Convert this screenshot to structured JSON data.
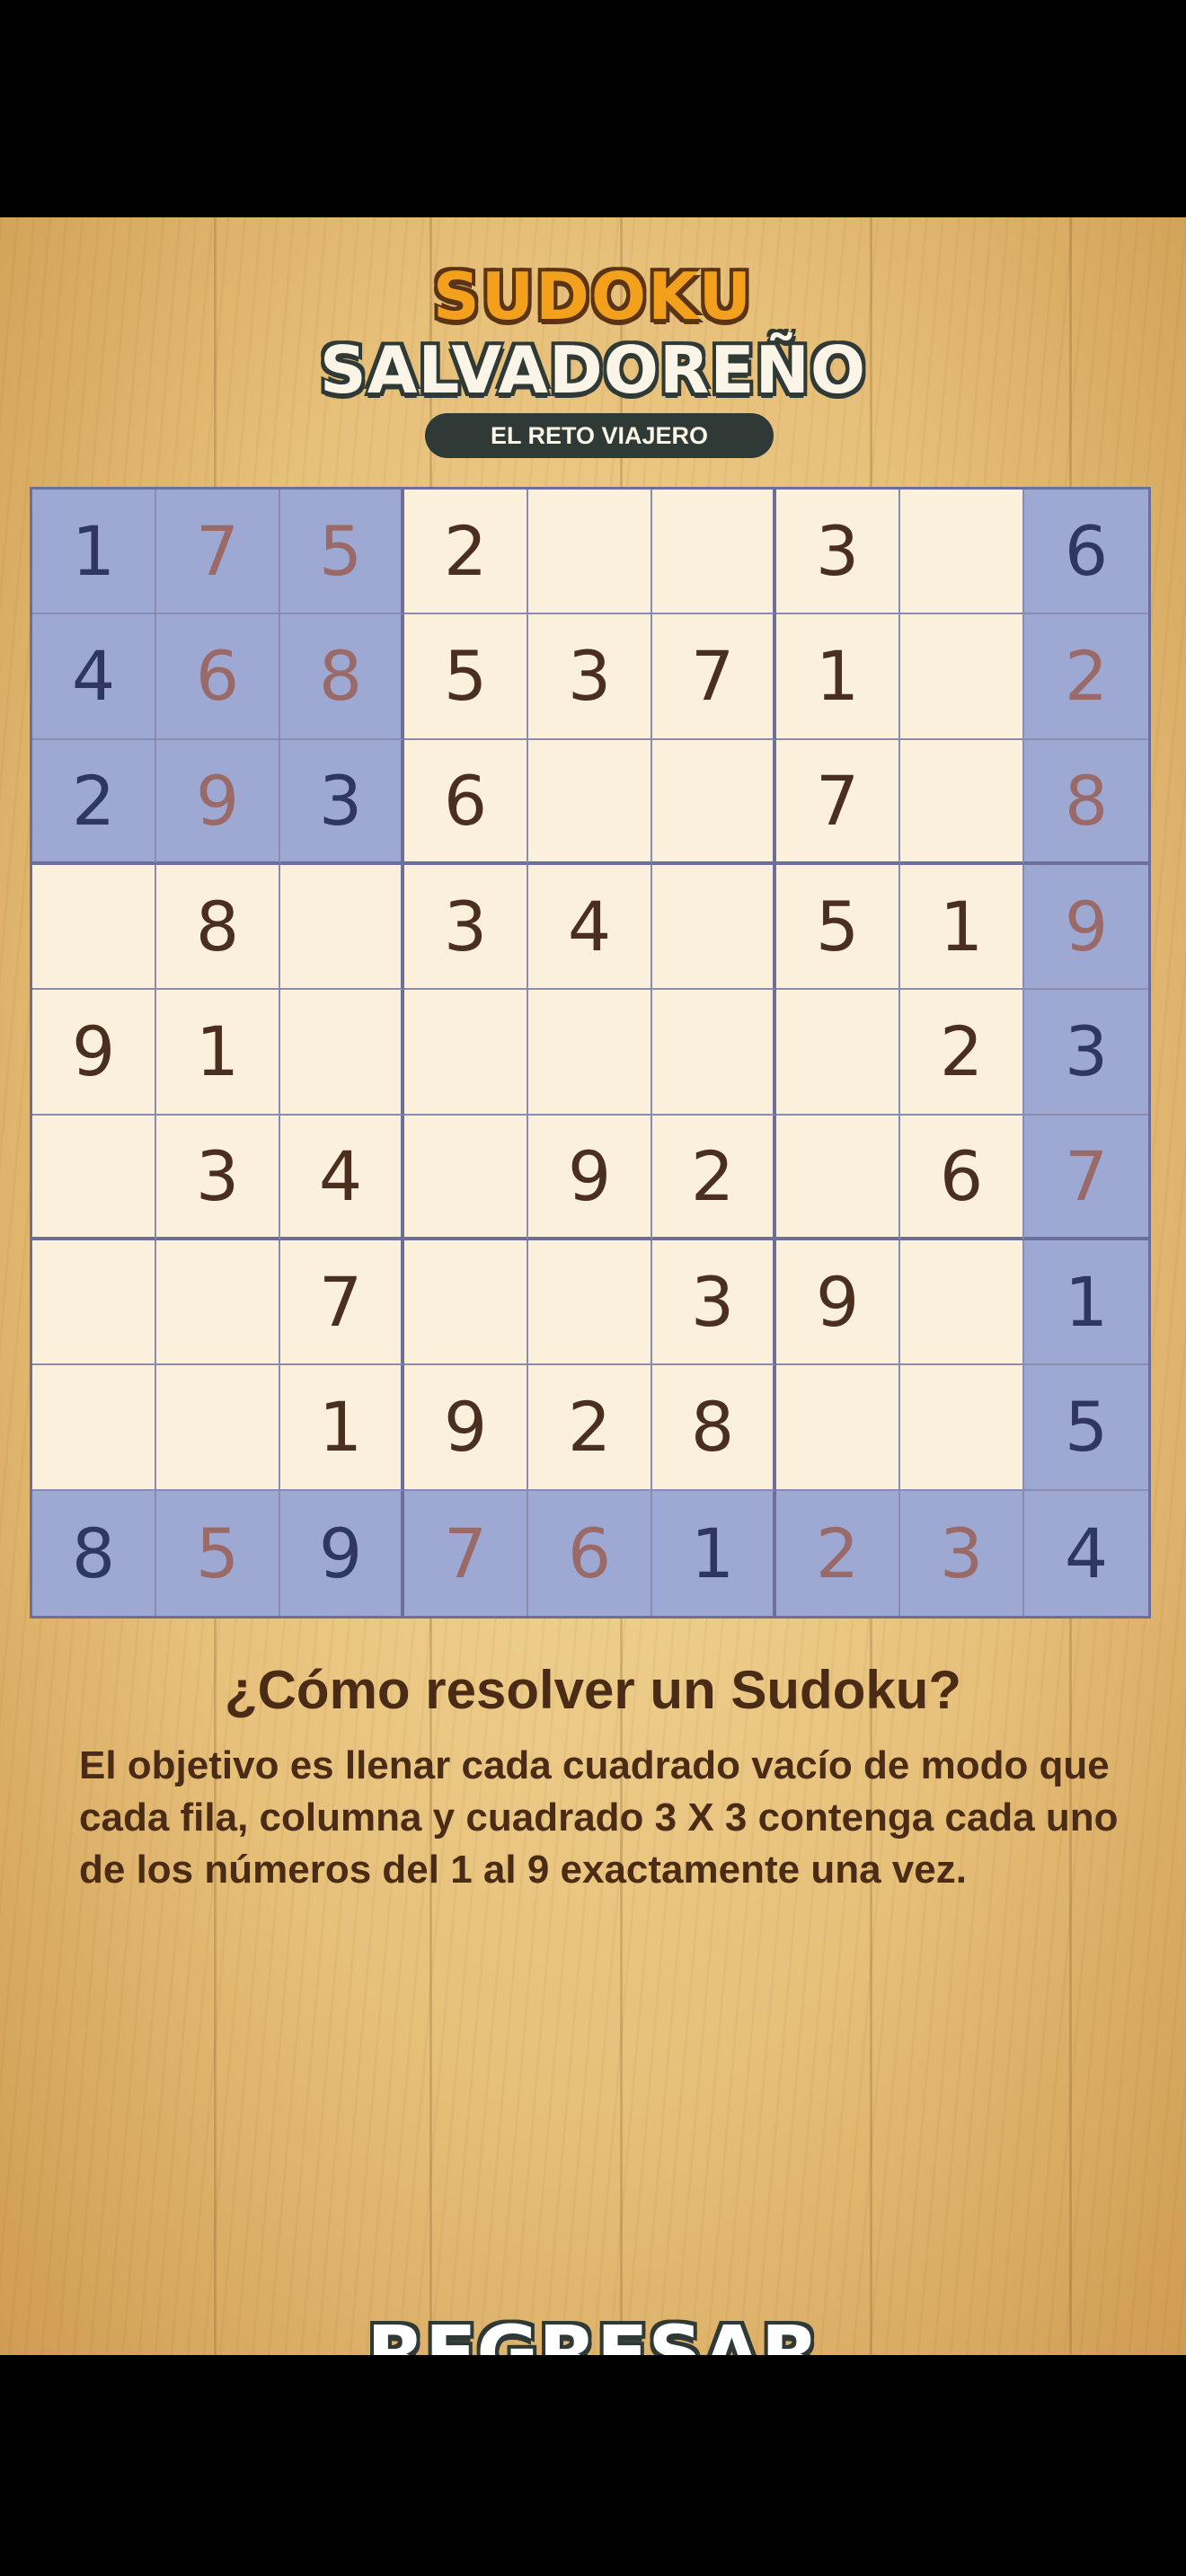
{
  "logo": {
    "title_line1": "SUDOKU",
    "title_line2": "SALVADOREÑO",
    "subtitle": "EL RETO VIAJERO"
  },
  "board": {
    "rows": [
      [
        "1",
        "7",
        "5",
        "2",
        "",
        "",
        "3",
        "",
        "6"
      ],
      [
        "4",
        "6",
        "8",
        "5",
        "3",
        "7",
        "1",
        "",
        "2"
      ],
      [
        "2",
        "9",
        "3",
        "6",
        "",
        "",
        "7",
        "",
        "8"
      ],
      [
        "",
        "8",
        "",
        "3",
        "4",
        "",
        "5",
        "1",
        "9"
      ],
      [
        "9",
        "1",
        "",
        "",
        "",
        "",
        "",
        "2",
        "3"
      ],
      [
        "",
        "3",
        "4",
        "",
        "9",
        "2",
        "",
        "6",
        "7"
      ],
      [
        "",
        "",
        "7",
        "",
        "",
        "3",
        "9",
        "",
        "1"
      ],
      [
        "",
        "",
        "1",
        "9",
        "2",
        "8",
        "",
        "",
        "5"
      ],
      [
        "8",
        "5",
        "9",
        "7",
        "6",
        "1",
        "2",
        "3",
        "4"
      ]
    ],
    "highlighted": [
      [
        1,
        1,
        1,
        0,
        0,
        0,
        0,
        0,
        1
      ],
      [
        1,
        1,
        1,
        0,
        0,
        0,
        0,
        0,
        1
      ],
      [
        1,
        1,
        1,
        0,
        0,
        0,
        0,
        0,
        1
      ],
      [
        0,
        0,
        0,
        0,
        0,
        0,
        0,
        0,
        1
      ],
      [
        0,
        0,
        0,
        0,
        0,
        0,
        0,
        0,
        1
      ],
      [
        0,
        0,
        0,
        0,
        0,
        0,
        0,
        0,
        1
      ],
      [
        0,
        0,
        0,
        0,
        0,
        0,
        0,
        0,
        1
      ],
      [
        0,
        0,
        0,
        0,
        0,
        0,
        0,
        0,
        1
      ],
      [
        1,
        1,
        1,
        1,
        1,
        1,
        1,
        1,
        1
      ]
    ],
    "player_entered": [
      [
        0,
        1,
        1,
        0,
        0,
        0,
        0,
        0,
        0
      ],
      [
        0,
        1,
        1,
        0,
        0,
        0,
        0,
        0,
        1
      ],
      [
        0,
        1,
        0,
        0,
        0,
        0,
        0,
        0,
        1
      ],
      [
        0,
        0,
        0,
        0,
        0,
        0,
        0,
        0,
        1
      ],
      [
        0,
        0,
        0,
        0,
        0,
        0,
        0,
        0,
        0
      ],
      [
        0,
        0,
        0,
        0,
        0,
        0,
        0,
        0,
        1
      ],
      [
        0,
        0,
        0,
        0,
        0,
        0,
        0,
        0,
        0
      ],
      [
        0,
        0,
        0,
        0,
        0,
        0,
        0,
        0,
        0
      ],
      [
        0,
        1,
        0,
        1,
        1,
        0,
        1,
        1,
        0
      ]
    ]
  },
  "howto": {
    "title": "¿Cómo resolver un Sudoku?",
    "text": "El objetivo es llenar cada cuadrado vacío de modo que cada fila, columna y cuadrado 3 X 3 contenga cada uno de los números del 1 al 9 exactamente una vez."
  },
  "back_button": {
    "label": "REGRESAR"
  },
  "colors": {
    "highlight": "#9da9d2",
    "cell_bg": "#fbf0dc",
    "given_digit": "#4a2e1e",
    "given_digit_on_highlight": "#2f3760",
    "player_digit": "#9a6a68"
  }
}
